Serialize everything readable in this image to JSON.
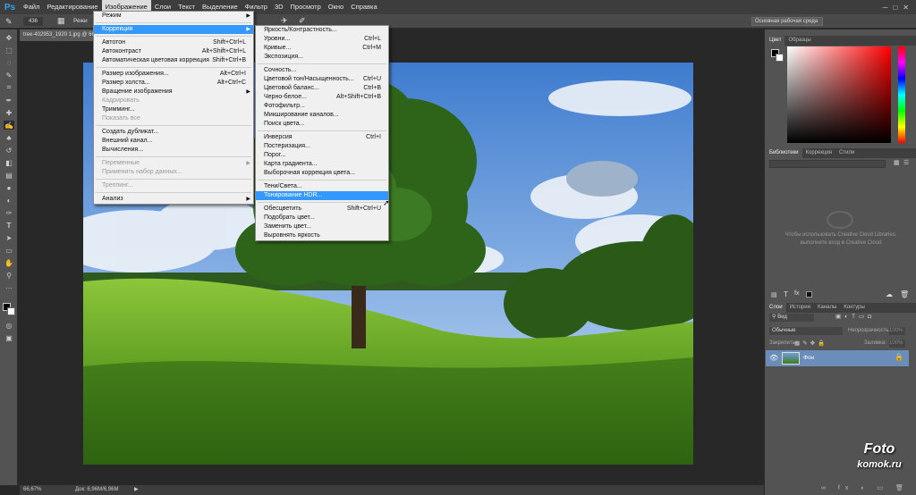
{
  "app": {
    "logo": "Ps"
  },
  "menubar": [
    "Файл",
    "Редактирование",
    "Изображение",
    "Слои",
    "Текст",
    "Выделение",
    "Фильтр",
    "3D",
    "Просмотр",
    "Окно",
    "Справка"
  ],
  "options_bar": {
    "brush_size": "436",
    "mode_label": "Режи"
  },
  "workspace": "Основная рабочая среда",
  "document": {
    "tab_title": "tree-402953_1920 1.jpg @ 66,7% (RGB/8*)",
    "zoom": "66,67%",
    "doc_size": "Док: 6,96M/6,96M"
  },
  "image_menu": [
    {
      "label": "Режим",
      "arrow": true
    },
    "sep",
    {
      "label": "Коррекция",
      "arrow": true,
      "hl": true
    },
    "sep",
    {
      "label": "Автотон",
      "shortcut": "Shift+Ctrl+L"
    },
    {
      "label": "Автоконтраст",
      "shortcut": "Alt+Shift+Ctrl+L"
    },
    {
      "label": "Автоматическая цветовая коррекция",
      "shortcut": "Shift+Ctrl+B"
    },
    "sep",
    {
      "label": "Размер изображения...",
      "shortcut": "Alt+Ctrl+I"
    },
    {
      "label": "Размер холста...",
      "shortcut": "Alt+Ctrl+C"
    },
    {
      "label": "Вращение изображения",
      "arrow": true
    },
    {
      "label": "Кадрировать",
      "dis": true
    },
    {
      "label": "Тримминг..."
    },
    {
      "label": "Показать все",
      "dis": true
    },
    "sep",
    {
      "label": "Создать дубликат..."
    },
    {
      "label": "Внешний канал..."
    },
    {
      "label": "Вычисления..."
    },
    "sep",
    {
      "label": "Переменные",
      "arrow": true,
      "dis": true
    },
    {
      "label": "Применить набор данных...",
      "dis": true
    },
    "sep",
    {
      "label": "Треппинг...",
      "dis": true
    },
    "sep",
    {
      "label": "Анализ",
      "arrow": true
    }
  ],
  "adjust_menu": [
    {
      "label": "Яркость/Контрастность..."
    },
    {
      "label": "Уровни...",
      "shortcut": "Ctrl+L"
    },
    {
      "label": "Кривые...",
      "shortcut": "Ctrl+M"
    },
    {
      "label": "Экспозиция..."
    },
    "sep",
    {
      "label": "Сочность..."
    },
    {
      "label": "Цветовой тон/Насыщенность...",
      "shortcut": "Ctrl+U"
    },
    {
      "label": "Цветовой баланс...",
      "shortcut": "Ctrl+B"
    },
    {
      "label": "Черно-белое...",
      "shortcut": "Alt+Shift+Ctrl+B"
    },
    {
      "label": "Фотофильтр..."
    },
    {
      "label": "Микширование каналов..."
    },
    {
      "label": "Поиск цвета..."
    },
    "sep",
    {
      "label": "Инверсия",
      "shortcut": "Ctrl+I"
    },
    {
      "label": "Постеризация..."
    },
    {
      "label": "Порог..."
    },
    {
      "label": "Карта градиента..."
    },
    {
      "label": "Выборочная коррекция цвета..."
    },
    "sep",
    {
      "label": "Тени/Света..."
    },
    {
      "label": "Тонирование HDR...",
      "hl": true
    },
    "sep",
    {
      "label": "Обесцветить",
      "shortcut": "Shift+Ctrl+U"
    },
    {
      "label": "Подобрать цвет..."
    },
    {
      "label": "Заменить цвет..."
    },
    {
      "label": "Выровнять яркость"
    }
  ],
  "panels": {
    "color_tabs": [
      "Цвет",
      "Образцы"
    ],
    "lib_tabs": [
      "Библиотеки",
      "Коррекция",
      "Стили"
    ],
    "cc_message": "Чтобы использовать Creative Cloud Libraries, выполните вход в Creative Cloud",
    "layers_tabs": [
      "Слои",
      "Истории",
      "Каналы",
      "Контуры"
    ],
    "kind_filter": "Вид",
    "blend_mode": "Обычные",
    "opacity_label": "Непрозрачность:",
    "opacity_value": "100%",
    "lock_label": "Закрепить:",
    "fill_label": "Заливка:",
    "fill_value": "100%",
    "layer_name": "Фон"
  },
  "watermark": {
    "line1": "Foto",
    "line2": "komok.ru"
  }
}
